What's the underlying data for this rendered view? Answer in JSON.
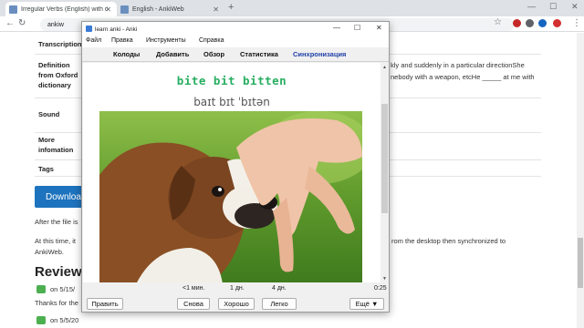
{
  "browser": {
    "tabs": [
      {
        "label": "Irregular Verbs (English) with def"
      },
      {
        "label": "English - AnkiWeb"
      }
    ],
    "new_tab": "+",
    "url": "ankiw",
    "window_controls": {
      "minimize": "—",
      "maximize": "☐",
      "close": "✕"
    }
  },
  "page": {
    "rows": [
      {
        "label": "Transcription",
        "value": ""
      },
      {
        "label": "Definition from Oxford dictionary",
        "value": "kly and suddenly in a particular directionShe",
        "value2": "nebody with a weapon, etcHe _____ at me with"
      },
      {
        "label": "Sound",
        "value": ""
      },
      {
        "label": "More infomation",
        "value": ""
      },
      {
        "label": "Tags",
        "value": ""
      }
    ],
    "download_label": "Downloa",
    "after_file_text": "After the file is",
    "time_text": "At this time, it",
    "time_text_right": "rom the desktop then synchronized to",
    "ankiweb_text": "AnkiWeb.",
    "reviews_heading": "Review",
    "review1": "on 5/15/",
    "thanks_text": "Thanks for the",
    "review2": "on 5/5/20"
  },
  "anki": {
    "title": "learn anki - Anki",
    "window_controls": {
      "minimize": "—",
      "maximize": "☐",
      "close": "✕"
    },
    "menu": [
      "Файл",
      "Правка",
      "Инструменты",
      "Справка"
    ],
    "nav": [
      "Колоды",
      "Добавить",
      "Обзор",
      "Статистика",
      "Синхронизация"
    ],
    "card": {
      "word": "bite bit bitten",
      "ipa": "baɪt bɪt ˈbɪtən"
    },
    "intervals": [
      "<1 мин.",
      "1 дн.",
      "4 дн."
    ],
    "timer": "0:25",
    "buttons": {
      "edit": "Править",
      "again": "Снова",
      "good": "Хорошо",
      "easy": "Легко",
      "more": "Ещё ▼"
    }
  }
}
